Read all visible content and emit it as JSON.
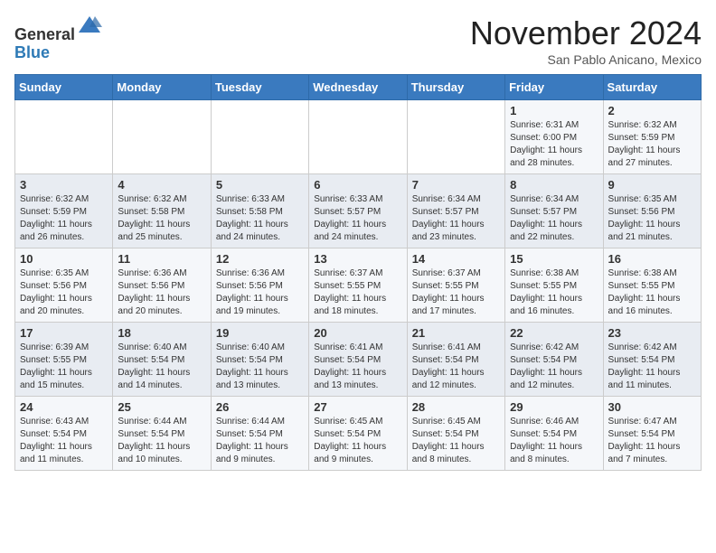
{
  "header": {
    "logo_line1": "General",
    "logo_line2": "Blue",
    "month": "November 2024",
    "location": "San Pablo Anicano, Mexico"
  },
  "weekdays": [
    "Sunday",
    "Monday",
    "Tuesday",
    "Wednesday",
    "Thursday",
    "Friday",
    "Saturday"
  ],
  "weeks": [
    [
      {
        "day": "",
        "info": ""
      },
      {
        "day": "",
        "info": ""
      },
      {
        "day": "",
        "info": ""
      },
      {
        "day": "",
        "info": ""
      },
      {
        "day": "",
        "info": ""
      },
      {
        "day": "1",
        "info": "Sunrise: 6:31 AM\nSunset: 6:00 PM\nDaylight: 11 hours\nand 28 minutes."
      },
      {
        "day": "2",
        "info": "Sunrise: 6:32 AM\nSunset: 5:59 PM\nDaylight: 11 hours\nand 27 minutes."
      }
    ],
    [
      {
        "day": "3",
        "info": "Sunrise: 6:32 AM\nSunset: 5:59 PM\nDaylight: 11 hours\nand 26 minutes."
      },
      {
        "day": "4",
        "info": "Sunrise: 6:32 AM\nSunset: 5:58 PM\nDaylight: 11 hours\nand 25 minutes."
      },
      {
        "day": "5",
        "info": "Sunrise: 6:33 AM\nSunset: 5:58 PM\nDaylight: 11 hours\nand 24 minutes."
      },
      {
        "day": "6",
        "info": "Sunrise: 6:33 AM\nSunset: 5:57 PM\nDaylight: 11 hours\nand 24 minutes."
      },
      {
        "day": "7",
        "info": "Sunrise: 6:34 AM\nSunset: 5:57 PM\nDaylight: 11 hours\nand 23 minutes."
      },
      {
        "day": "8",
        "info": "Sunrise: 6:34 AM\nSunset: 5:57 PM\nDaylight: 11 hours\nand 22 minutes."
      },
      {
        "day": "9",
        "info": "Sunrise: 6:35 AM\nSunset: 5:56 PM\nDaylight: 11 hours\nand 21 minutes."
      }
    ],
    [
      {
        "day": "10",
        "info": "Sunrise: 6:35 AM\nSunset: 5:56 PM\nDaylight: 11 hours\nand 20 minutes."
      },
      {
        "day": "11",
        "info": "Sunrise: 6:36 AM\nSunset: 5:56 PM\nDaylight: 11 hours\nand 20 minutes."
      },
      {
        "day": "12",
        "info": "Sunrise: 6:36 AM\nSunset: 5:56 PM\nDaylight: 11 hours\nand 19 minutes."
      },
      {
        "day": "13",
        "info": "Sunrise: 6:37 AM\nSunset: 5:55 PM\nDaylight: 11 hours\nand 18 minutes."
      },
      {
        "day": "14",
        "info": "Sunrise: 6:37 AM\nSunset: 5:55 PM\nDaylight: 11 hours\nand 17 minutes."
      },
      {
        "day": "15",
        "info": "Sunrise: 6:38 AM\nSunset: 5:55 PM\nDaylight: 11 hours\nand 16 minutes."
      },
      {
        "day": "16",
        "info": "Sunrise: 6:38 AM\nSunset: 5:55 PM\nDaylight: 11 hours\nand 16 minutes."
      }
    ],
    [
      {
        "day": "17",
        "info": "Sunrise: 6:39 AM\nSunset: 5:55 PM\nDaylight: 11 hours\nand 15 minutes."
      },
      {
        "day": "18",
        "info": "Sunrise: 6:40 AM\nSunset: 5:54 PM\nDaylight: 11 hours\nand 14 minutes."
      },
      {
        "day": "19",
        "info": "Sunrise: 6:40 AM\nSunset: 5:54 PM\nDaylight: 11 hours\nand 13 minutes."
      },
      {
        "day": "20",
        "info": "Sunrise: 6:41 AM\nSunset: 5:54 PM\nDaylight: 11 hours\nand 13 minutes."
      },
      {
        "day": "21",
        "info": "Sunrise: 6:41 AM\nSunset: 5:54 PM\nDaylight: 11 hours\nand 12 minutes."
      },
      {
        "day": "22",
        "info": "Sunrise: 6:42 AM\nSunset: 5:54 PM\nDaylight: 11 hours\nand 12 minutes."
      },
      {
        "day": "23",
        "info": "Sunrise: 6:42 AM\nSunset: 5:54 PM\nDaylight: 11 hours\nand 11 minutes."
      }
    ],
    [
      {
        "day": "24",
        "info": "Sunrise: 6:43 AM\nSunset: 5:54 PM\nDaylight: 11 hours\nand 11 minutes."
      },
      {
        "day": "25",
        "info": "Sunrise: 6:44 AM\nSunset: 5:54 PM\nDaylight: 11 hours\nand 10 minutes."
      },
      {
        "day": "26",
        "info": "Sunrise: 6:44 AM\nSunset: 5:54 PM\nDaylight: 11 hours\nand 9 minutes."
      },
      {
        "day": "27",
        "info": "Sunrise: 6:45 AM\nSunset: 5:54 PM\nDaylight: 11 hours\nand 9 minutes."
      },
      {
        "day": "28",
        "info": "Sunrise: 6:45 AM\nSunset: 5:54 PM\nDaylight: 11 hours\nand 8 minutes."
      },
      {
        "day": "29",
        "info": "Sunrise: 6:46 AM\nSunset: 5:54 PM\nDaylight: 11 hours\nand 8 minutes."
      },
      {
        "day": "30",
        "info": "Sunrise: 6:47 AM\nSunset: 5:54 PM\nDaylight: 11 hours\nand 7 minutes."
      }
    ]
  ]
}
